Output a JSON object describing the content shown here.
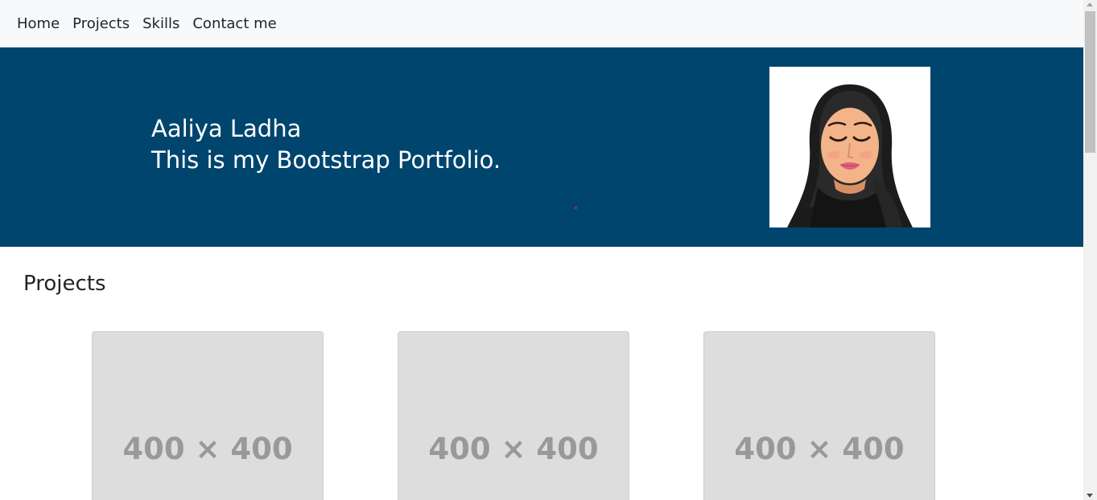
{
  "nav": {
    "items": [
      {
        "label": "Home"
      },
      {
        "label": "Projects"
      },
      {
        "label": "Skills"
      },
      {
        "label": "Contact me"
      }
    ]
  },
  "hero": {
    "name": "Aaliya Ladha",
    "tagline": "This is my Bootstrap Portfolio.",
    "background_color": "#00456e",
    "avatar_icon": "woman-in-hijab-avatar"
  },
  "projects": {
    "title": "Projects",
    "cards": [
      {
        "placeholder": "400 × 400"
      },
      {
        "placeholder": "400 × 400"
      },
      {
        "placeholder": "400 × 400"
      }
    ]
  }
}
